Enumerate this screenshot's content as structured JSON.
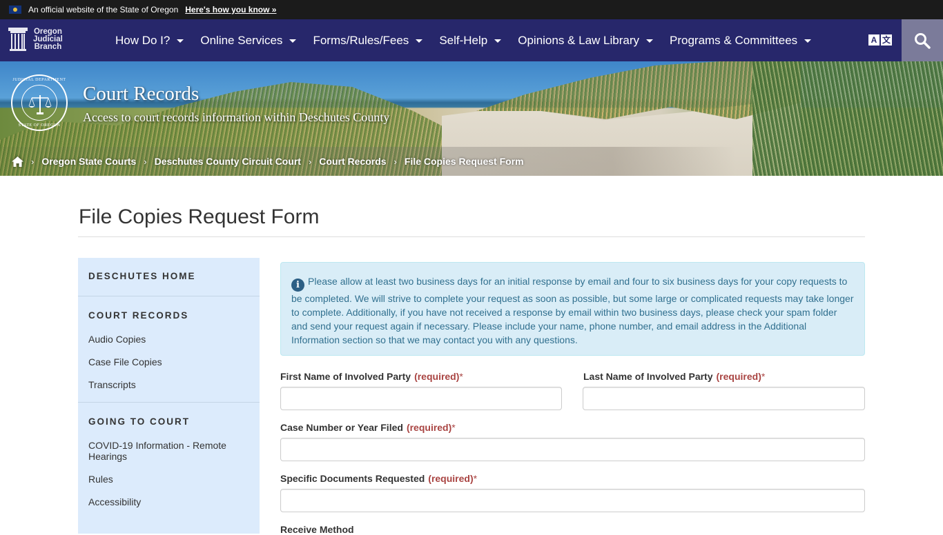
{
  "official_banner": {
    "flag_icon": "oregon-flag-icon",
    "text": "An official website of the State of Oregon",
    "link": "Here's how you know »"
  },
  "nav": {
    "brand": {
      "icon": "column-icon",
      "line1": "Oregon",
      "line2": "Judicial",
      "line3": "Branch"
    },
    "items": [
      {
        "label": "How Do I?"
      },
      {
        "label": "Online Services"
      },
      {
        "label": "Forms/Rules/Fees"
      },
      {
        "label": "Self-Help"
      },
      {
        "label": "Opinions & Law Library"
      },
      {
        "label": "Programs & Committees"
      }
    ],
    "translate": {
      "a": "A",
      "b": "文"
    },
    "search_icon": "search-icon"
  },
  "hero": {
    "seal": {
      "top": "JUDICIAL DEPARTMENT",
      "bottom": "STATE OF OREGON"
    },
    "title": "Court Records",
    "subtitle": "Access to court records information within Deschutes County"
  },
  "breadcrumb": {
    "home_icon": "home-icon",
    "items": [
      {
        "label": "Oregon State Courts"
      },
      {
        "label": "Deschutes County Circuit Court"
      },
      {
        "label": "Court Records"
      },
      {
        "label": "File Copies Request Form"
      }
    ]
  },
  "page": {
    "title": "File Copies Request Form"
  },
  "sidebar": {
    "home": "DESCHUTES HOME",
    "sections": [
      {
        "heading": "COURT RECORDS",
        "links": [
          "Audio Copies",
          "Case File Copies",
          "Transcripts"
        ]
      },
      {
        "heading": "GOING TO COURT",
        "links": [
          "COVID-19 Information - Remote Hearings",
          "Rules",
          "Accessibility"
        ]
      }
    ]
  },
  "alert": {
    "icon": "info-icon",
    "text": "Please allow at least two business days for an initial response by email and four to six business days for your copy requests to be completed. We will strive to complete your request as soon as possible, but some large or complicated requests may take longer to complete. Additionally, if you have not received a response by email within two business days, please check your spam folder and send your request again if necessary. Please include your name, phone number, and email address in the Additional Information section so that we may contact you with any questions."
  },
  "form": {
    "required_text": "(required)",
    "required_star": "*",
    "fields": {
      "first_name": {
        "label": "First Name of Involved Party",
        "value": ""
      },
      "last_name": {
        "label": "Last Name of Involved Party",
        "value": ""
      },
      "case_number": {
        "label": "Case Number or Year Filed",
        "value": ""
      },
      "documents": {
        "label": "Specific Documents Requested",
        "value": ""
      },
      "receive_method": {
        "label": "Receive Method"
      }
    }
  },
  "colors": {
    "nav_bg": "#27276b",
    "official_bar_bg": "#1b1b1b",
    "sidebar_bg": "#dcebfc",
    "alert_bg": "#d9edf7",
    "alert_text": "#31708f",
    "required": "#a94442",
    "search_btn_bg": "#7b7b9a"
  }
}
